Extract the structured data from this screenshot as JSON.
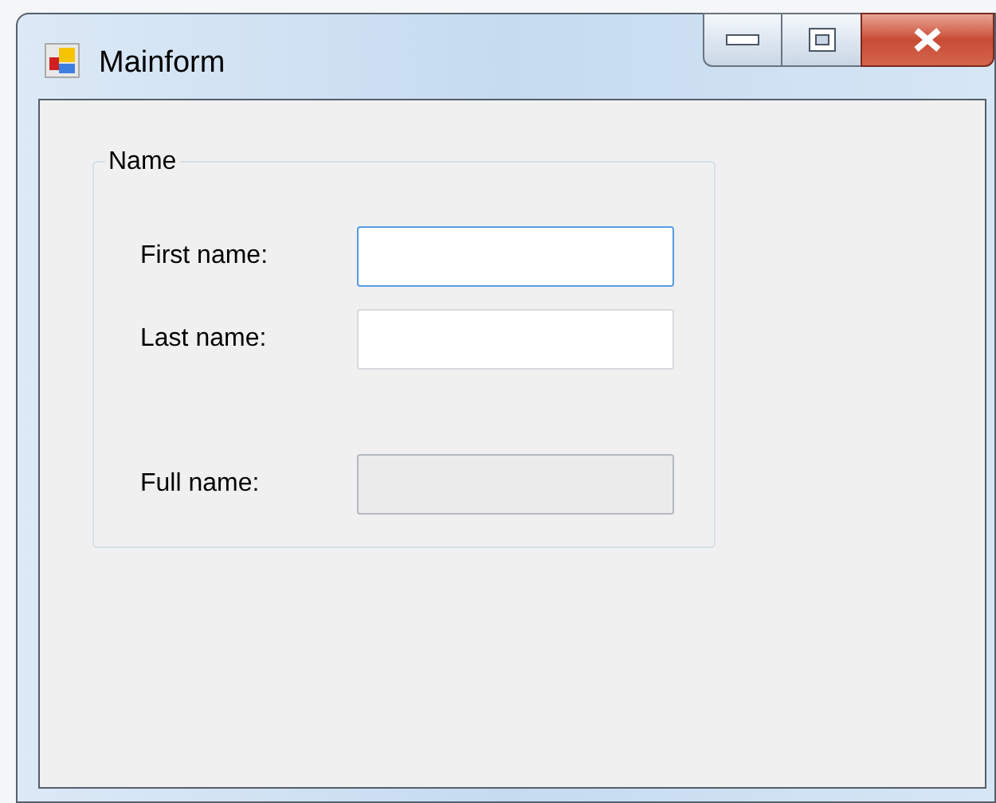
{
  "window": {
    "title": "Mainform"
  },
  "group": {
    "title": "Name"
  },
  "fields": [
    {
      "label": "First name:",
      "focused": true,
      "disabled": false
    },
    {
      "label": "Last name:",
      "focused": false,
      "disabled": false
    },
    {
      "label": "Full name:",
      "focused": false,
      "disabled": true
    }
  ]
}
